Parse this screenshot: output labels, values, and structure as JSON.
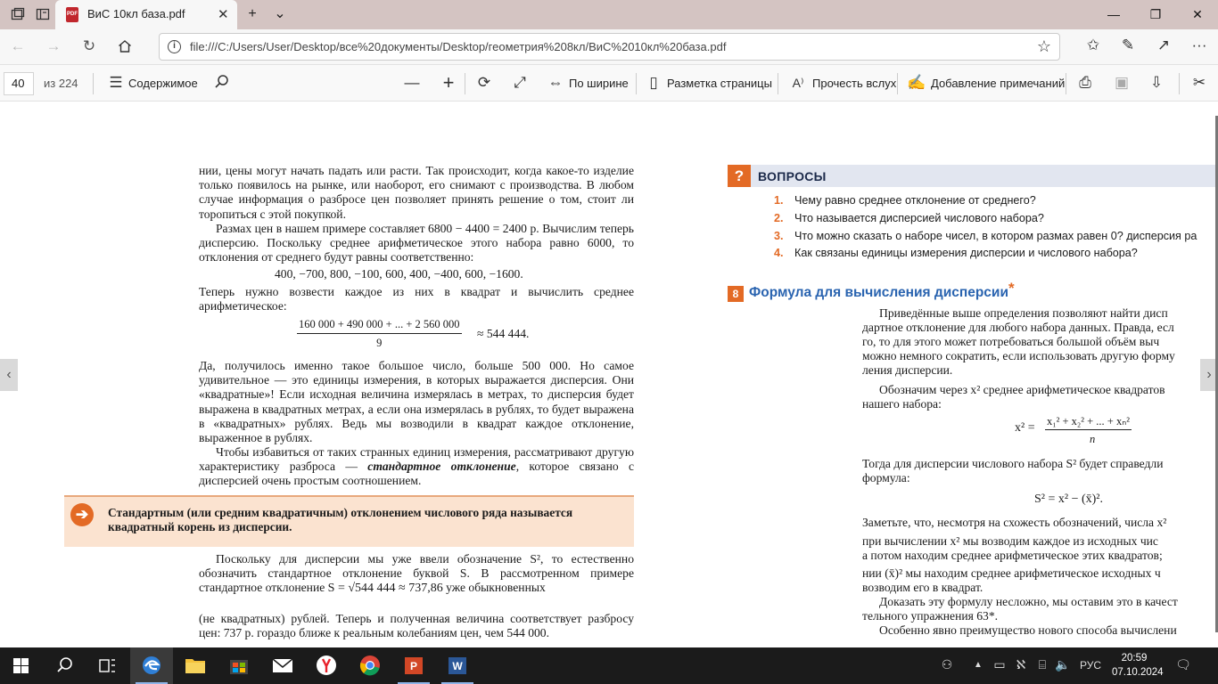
{
  "browser": {
    "tab_title": "ВиС 10кл база.pdf",
    "url": "file:///C:/Users/User/Desktop/все%20документы/Desktop/геометрия%208кл/ВиС%2010кл%20база.pdf"
  },
  "pdf_toolbar": {
    "current_page": "40",
    "page_total": "из 224",
    "contents_label": "Содержимое",
    "fit_width_label": "По ширине",
    "page_layout_label": "Разметка страницы",
    "read_aloud_label": "Прочесть вслух",
    "add_note_label": "Добавление примечаний"
  },
  "left_column": {
    "p1": "нии, цены могут начать падать или расти. Так происходит, когда какое-то изделие только появилось на рынке, или наоборот, его снимают с производства. В любом случае информация о разбросе цен позволяет принять решение о том, стоит ли торопиться с этой покупкой.",
    "p2": "Размах цен в нашем примере составляет 6800 − 4400 = 2400 р. Вычислим теперь дисперсию. Поскольку среднее арифметическое этого набора равно 6000, то отклонения от среднего будут равны соответственно:",
    "deviations": "400, −700, 800, −100, 600, 400, −400, 600, −1600.",
    "p3": "Теперь нужно возвести каждое из них в квадрат и вычислить среднее арифметическое:",
    "fraction_num": "160 000 + 490 000 + ... + 2 560 000",
    "fraction_den": "9",
    "fraction_result": "≈ 544 444.",
    "p4": "Да, получилось именно такое большое число, больше 500 000. Но самое удивительное — это единицы измерения, в которых выражается дисперсия. Они «квадратные»! Если исходная величина измерялась в метрах, то дисперсия будет выражена в квадратных метрах, а если она измерялась в рублях, то будет выражена в «квадратных» рублях. Ведь мы возводили в квадрат каждое отклонение, выраженное в рублях.",
    "p5_start": "Чтобы избавиться от таких странных единиц измерения, рассматривают другую характеристику разброса — ",
    "p5_term": "стандартное отклонение",
    "p5_end": ", которое связано с дисперсией очень простым соотношением.",
    "definition": "Стандартным (или средним квадратичным) отклонением числового ряда называется квадратный корень из дисперсии.",
    "p6_start": "Поскольку для дисперсии мы уже ввели обозначение S², то естественно обозначить стандартное отклонение буквой S. В рассмотренном примере стандартное отклонение ",
    "p6_formula": "S = √544 444 ≈ 737,86",
    "p6_end": " уже обыкновенных",
    "p7": "(не квадратных) рублей. Теперь и полученная величина соответствует разбросу цен: 737 р. гораздо ближе к реальным колебаниям цен, чем 544 000."
  },
  "questions": {
    "header": "ВОПРОСЫ",
    "items": [
      {
        "num": "1.",
        "text": "Чему равно среднее отклонение от среднего?"
      },
      {
        "num": "2.",
        "text": "Что называется дисперсией числового набора?"
      },
      {
        "num": "3.",
        "text": "Что можно сказать о наборе чисел, в котором размах равен 0? дисперсия ра"
      },
      {
        "num": "4.",
        "text": "Как связаны единицы измерения дисперсии и числового набора?"
      }
    ]
  },
  "section": {
    "number": "8",
    "title": "Формула для вычисления дисперсии",
    "star": "*",
    "r1": "Приведённые выше определения позволяют найти дисп",
    "r2": "дартное отклонение для любого набора данных. Правда, есл",
    "r3": "го, то для этого может потребоваться большой объём выч",
    "r4": "можно немного сократить, если использовать другую форму",
    "r5": "ления дисперсии.",
    "r6": "Обозначим через x² среднее арифметическое квадратов",
    "r7": "нашего набора:",
    "formula1_lhs": "x² =",
    "formula1_num": "x₁² + x₂² + ... + xₙ²",
    "formula1_den": "n",
    "r8": "Тогда для дисперсии числового набора S² будет справедли",
    "r9": "формула:",
    "formula2": "S² = x² − (x̄)².",
    "r10": "Заметьте, что, несмотря на схожесть обозначений, числа x²",
    "r11": "при вычислении x² мы возводим каждое из исходных чис",
    "r12": "а потом находим среднее арифметическое этих квадратов;",
    "r13": "нии (x̄)² мы находим среднее арифметическое исходных ч",
    "r14": "возводим его в квадрат.",
    "r15": "Доказать эту формулу несложно, мы оставим это в качест",
    "r16": "тельного упражнения 63*.",
    "r17": "Особенно явно преимущество нового способа вычислени"
  },
  "taskbar": {
    "time": "20:59",
    "date": "07.10.2024",
    "lang": "РУС"
  }
}
